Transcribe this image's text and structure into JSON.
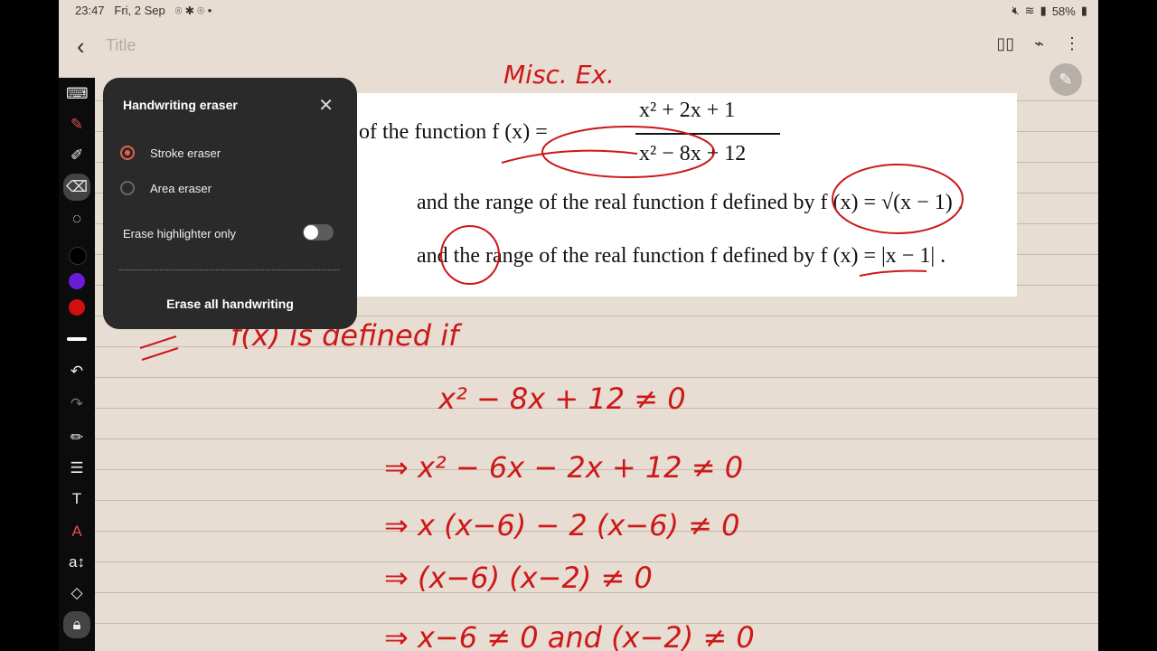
{
  "status": {
    "time": "23:47",
    "date": "Fri, 2 Sep",
    "battery": "58%"
  },
  "note": {
    "title_placeholder": "Title"
  },
  "doc": {
    "line1_prefix": "of the function ",
    "line1_fx": "f (x) =",
    "line1_num": "x² + 2x + 1",
    "line1_den": "x² − 8x + 12",
    "line2": "and the range of the real function f defined by f (x) = √(x − 1) .",
    "line3": "and the range of the real function f defined by f (x) = |x − 1| ."
  },
  "eraser_panel": {
    "title": "Handwriting eraser",
    "stroke_eraser": "Stroke eraser",
    "area_eraser": "Area eraser",
    "selected": "Stroke eraser",
    "highlighter_only_label": "Erase highlighter only",
    "highlighter_only": false,
    "erase_all": "Erase all handwriting"
  },
  "handwriting": {
    "heading": "Misc. Ex.",
    "l1": "f(x)  is  defined  if",
    "l2": "x² − 8x + 12 ≠ 0",
    "l3": "⇒  x² − 6x − 2x + 12  ≠ 0",
    "l4": "⇒  x (x−6) − 2 (x−6) ≠ 0",
    "l5": "⇒   (x−6) (x−2) ≠ 0",
    "l6": "⇒  x−6 ≠ 0   and  (x−2) ≠ 0"
  },
  "colors": {
    "ink": "#cc1818",
    "accent": "#e0634f",
    "paper": "#e8ddd2"
  }
}
